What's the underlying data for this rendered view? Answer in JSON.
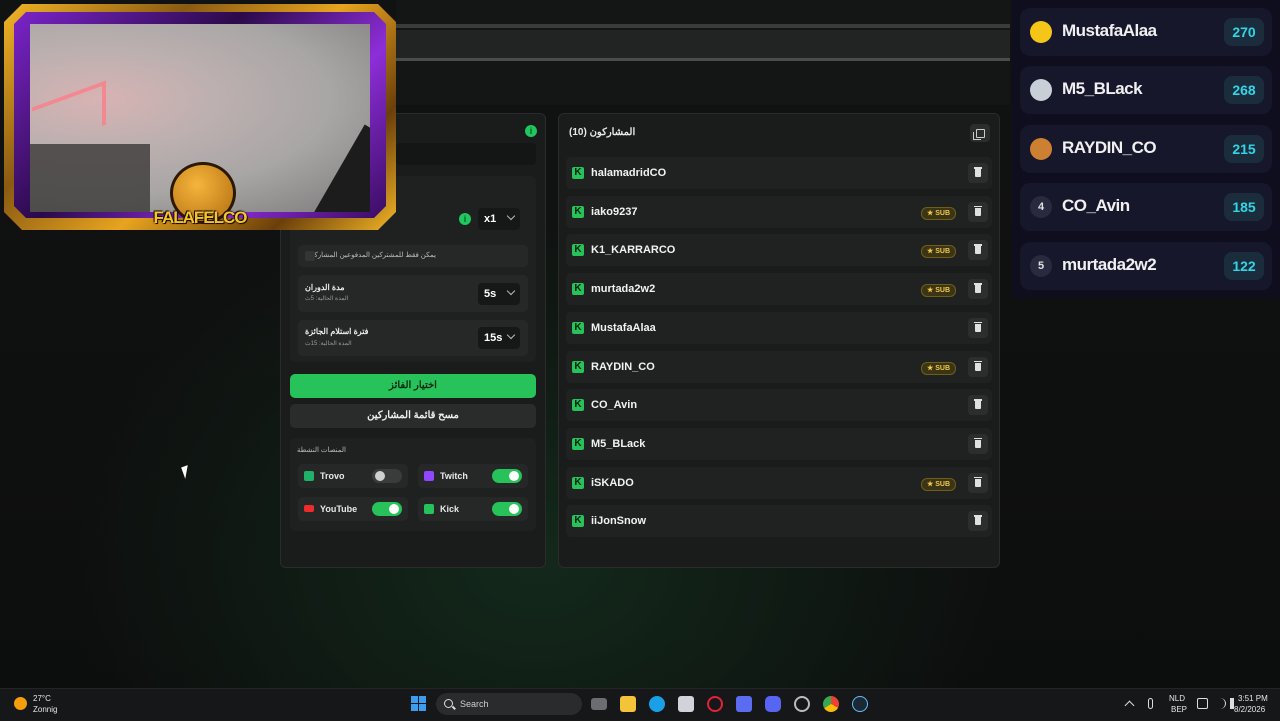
{
  "colors": {
    "accent": "#27c25a",
    "score": "#33d4e6",
    "sub_badge": "#f2c94c",
    "frame_gold": "#f2b526",
    "frame_purple": "#8d2ed8"
  },
  "webcam": {
    "logo_text": "FALAFELCO"
  },
  "settings": {
    "multiplier": "x1",
    "subs_only_label": "يمكن فقط للمشتركين المدفوعين المشاركة",
    "spin_duration": {
      "title": "مدة الدوران",
      "current": "المدة الحالية: 5ث",
      "value": "5s"
    },
    "claim_period": {
      "title": "فترة استلام الجائزة",
      "current": "المدة الحالية: 15ث",
      "value": "15s"
    },
    "pick_winner": "اختيار الفائز",
    "clear_list": "مسح قائمة المشاركين",
    "platforms_title": "المنصات النشطة",
    "platforms": [
      {
        "name": "Trovo",
        "icon": "trovo-icon",
        "on": false
      },
      {
        "name": "Twitch",
        "icon": "twitch-icon",
        "on": true
      },
      {
        "name": "YouTube",
        "icon": "youtube-icon",
        "on": true
      },
      {
        "name": "Kick",
        "icon": "kick-icon",
        "on": true
      }
    ]
  },
  "participants": {
    "title": "المشاركون (10)",
    "sub_label": "SUB",
    "kick_glyph": "K",
    "rows": [
      {
        "name": "halamadridCO",
        "sub": false
      },
      {
        "name": "iako9237",
        "sub": true
      },
      {
        "name": "K1_KARRARCO",
        "sub": true
      },
      {
        "name": "murtada2w2",
        "sub": true
      },
      {
        "name": "MustafaAlaa",
        "sub": false
      },
      {
        "name": "RAYDIN_CO",
        "sub": true
      },
      {
        "name": "CO_Avin",
        "sub": false
      },
      {
        "name": "M5_BLack",
        "sub": false
      },
      {
        "name": "iSKADO",
        "sub": true
      },
      {
        "name": "iiJonSnow",
        "sub": false
      }
    ]
  },
  "leaderboard": [
    {
      "rank": "",
      "medal": "gold",
      "name": "MustafaAlaa",
      "score": "270"
    },
    {
      "rank": "",
      "medal": "silver",
      "name": "M5_BLack",
      "score": "268"
    },
    {
      "rank": "",
      "medal": "bronze",
      "name": "RAYDIN_CO",
      "score": "215"
    },
    {
      "rank": "4",
      "medal": "",
      "name": "CO_Avin",
      "score": "185"
    },
    {
      "rank": "5",
      "medal": "",
      "name": "murtada2w2",
      "score": "122"
    }
  ],
  "taskbar": {
    "weather_temp": "27°C",
    "weather_desc": "Zonnig",
    "search_placeholder": "Search",
    "lang1": "NLD",
    "lang2": "BEP",
    "time": "3:51 PM",
    "date": "8/2/2026"
  }
}
